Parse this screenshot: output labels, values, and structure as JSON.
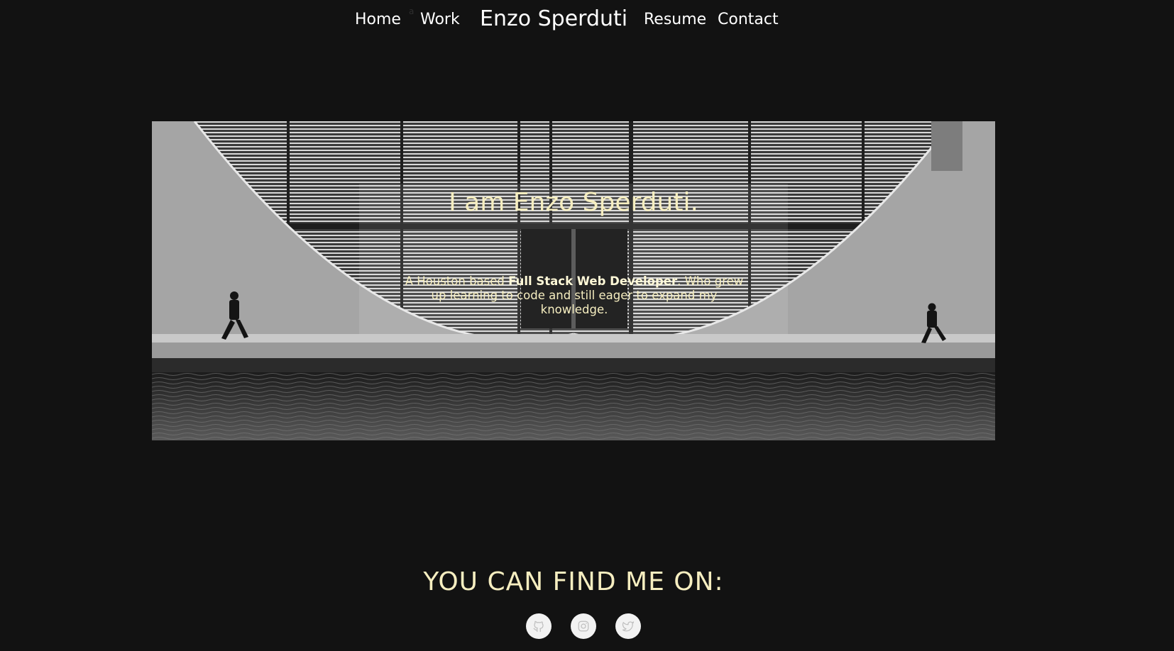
{
  "nav": {
    "home": "Home",
    "tiny_mark": "a",
    "work": "Work",
    "brand": "Enzo Sperduti",
    "resume": "Resume",
    "contact": "Contact"
  },
  "hero": {
    "title": "I am Enzo Sperduti.",
    "sub_before": "A Houston based ",
    "sub_bold": "Full Stack Web Developer",
    "sub_after": ". Who grew up learning to code and still eager to expand my knowledge."
  },
  "find": {
    "title": "YOU CAN FIND ME ON:"
  },
  "socials": [
    {
      "icon": "github-icon"
    },
    {
      "icon": "instagram-icon"
    },
    {
      "icon": "twitter-icon"
    }
  ],
  "colors": {
    "background": "#121212",
    "accent": "#f6eec0",
    "nav_text": "#ffffff",
    "icon_bg": "#f2f2f2",
    "icon_fg": "#bdbdbd"
  }
}
